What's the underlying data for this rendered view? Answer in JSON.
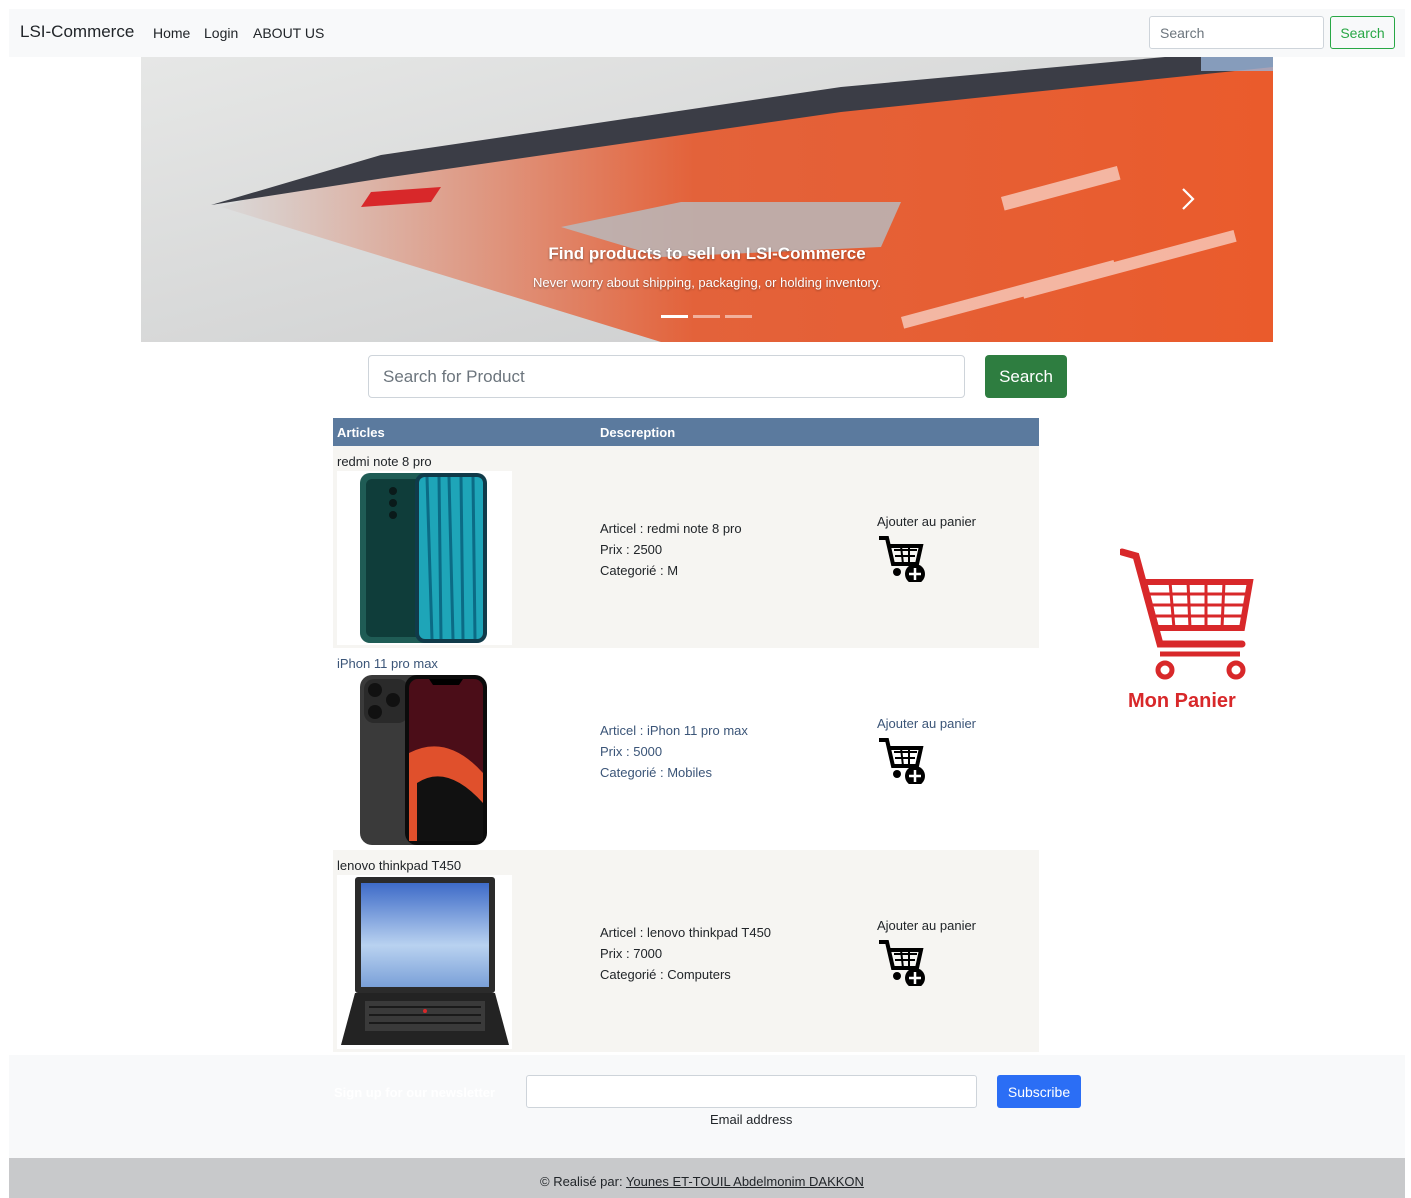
{
  "navbar": {
    "brand": "LSI-Commerce",
    "links": [
      "Home",
      "Login",
      "ABOUT US"
    ],
    "search_placeholder": "Search",
    "search_button": "Search"
  },
  "carousel": {
    "title": "Find products to sell on LSI-Commerce",
    "text": "Never worry about shipping, packaging, or holding inventory.",
    "slide_count": 3,
    "active_slide": 1
  },
  "product_search": {
    "placeholder": "Search for Product",
    "button": "Search"
  },
  "table": {
    "headers": [
      "Articles",
      "Descreption"
    ],
    "rows": [
      {
        "name": "redmi note 8 pro",
        "article": "Articel : redmi note 8 pro",
        "price": "Prix : 2500",
        "category": "Categorié : M",
        "add_label": "Ajouter au panier"
      },
      {
        "name": "iPhon 11 pro max",
        "article": "Articel : iPhon 11 pro max",
        "price": "Prix : 5000",
        "category": "Categorié : Mobiles",
        "add_label": "Ajouter au panier"
      },
      {
        "name": "lenovo thinkpad T450",
        "article": "Articel : lenovo thinkpad T450",
        "price": "Prix : 7000",
        "category": "Categorié : Computers",
        "add_label": "Ajouter au panier"
      }
    ]
  },
  "cart": {
    "label": "Mon Panier"
  },
  "newsletter": {
    "label": "Sign up for our newsletter",
    "email_label": "Email address",
    "button": "Subscribe"
  },
  "footer": {
    "prefix": "© Realisé par:",
    "authors": "Younes ET-TOUIL Abdelmonim DAKKON"
  },
  "colors": {
    "table_header": "#5b7a9e",
    "search_button": "#2e7d40",
    "subscribe_button": "#2b6ef5",
    "cart_red": "#d8282a"
  }
}
